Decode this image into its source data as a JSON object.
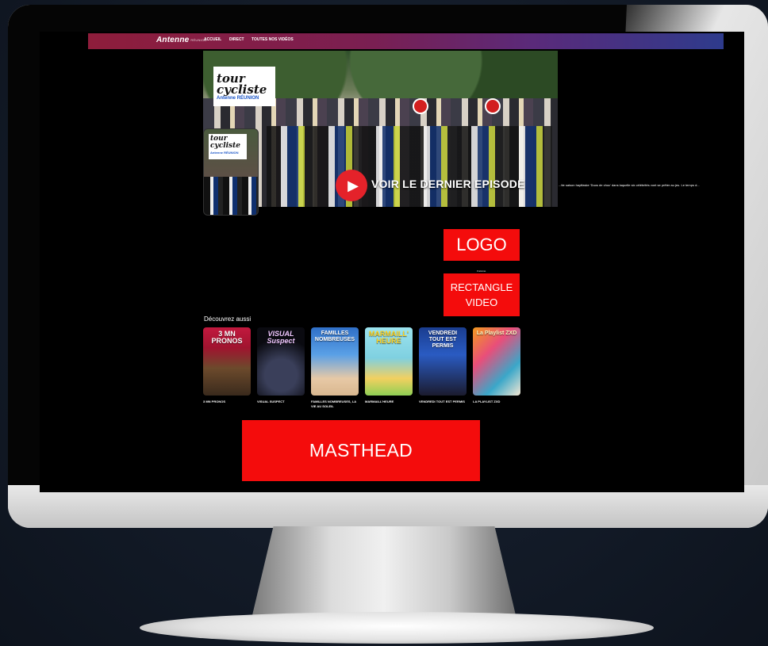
{
  "nav": {
    "logo": "Antenne",
    "logo_sub": "RÉUNION",
    "links": [
      "ACCUEIL",
      "DIRECT",
      "TOUTES NOS VIDÉOS"
    ]
  },
  "hero": {
    "card_title": "tour cycliste",
    "card_brand": "Antenne RÉUNION",
    "cta": "VOIR LE DERNIER EPISODE",
    "description": "...tte saison haytfaske 'Duos de choc' dans laquelle six célébrités vont se prêter au jeu. Le temps d..."
  },
  "placeholders": {
    "logo": "LOGO",
    "caption": "Publicité",
    "rect_line1": "RECTANGLE",
    "rect_line2": "VIDEO",
    "masthead": "MASTHEAD"
  },
  "section": {
    "title": "Découvrez aussi",
    "items": [
      {
        "label": "3 MN PRONOS",
        "art_text": "3 MN PRONOS"
      },
      {
        "label": "VISUAL SUSPECT",
        "art_text": "VISUAL Suspect"
      },
      {
        "label": "FAMILLES NOMBREUSES, LA VIE AU SOLEIL",
        "art_text": "FAMILLES NOMBREUSES"
      },
      {
        "label": "MARMAILL'HEURE",
        "art_text": "MARMAILL' HEURE"
      },
      {
        "label": "VENDREDI TOUT EST PERMIS",
        "art_text": "VENDREDI TOUT EST PERMIS"
      },
      {
        "label": "LA PLAYLIST ZXD",
        "art_text": "La Playlist ZXD"
      }
    ]
  },
  "colors": {
    "placeholder_red": "#f40c0c",
    "play_red": "#e4222a",
    "nav_gradient_start": "#8e1d3b",
    "nav_gradient_end": "#2e3b8c"
  }
}
